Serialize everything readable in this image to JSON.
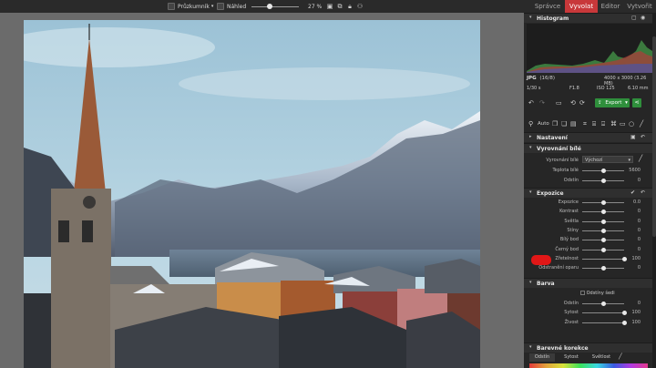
{
  "topbar": {
    "explorer_label": "Průzkumník",
    "preview_label": "Náhled",
    "zoom": "27 %",
    "zoom_fraction": 0.38,
    "tabs": [
      {
        "label": "Správce"
      },
      {
        "label": "Vyvolat"
      },
      {
        "label": "Editor"
      },
      {
        "label": "Vytvořit"
      }
    ],
    "active_tab": "Vyvolat",
    "accent_color": "#c8383a"
  },
  "histogram": {
    "title": "Histogram",
    "file_type": "JPG",
    "bit_depth": "(16/8)",
    "dimensions": "4000 x 3000 (3.26 MB)",
    "shutter": "1/30 s",
    "aperture": "F1.8",
    "iso": "ISO 125",
    "focal": "6.10 mm"
  },
  "toolbar": {
    "export_label": "Export",
    "auto_label": "Auto"
  },
  "sections": {
    "nastaveni": "Nastavení",
    "white_balance": {
      "title": "Vyrovnání bílé",
      "wb_label": "Vyrovnání bílé",
      "wb_value": "Výchozí",
      "temp_label": "Teplota bílé",
      "temp_value": "5600",
      "temp_fraction": 0.5,
      "tint_label": "Odstín",
      "tint_value": "0",
      "tint_fraction": 0.5
    },
    "exposure": {
      "title": "Expozice",
      "rows": [
        {
          "label": "Expozice",
          "value": "0.0",
          "fraction": 0.5
        },
        {
          "label": "Kontrast",
          "value": "0",
          "fraction": 0.5
        },
        {
          "label": "Světla",
          "value": "0",
          "fraction": 0.5
        },
        {
          "label": "Stíny",
          "value": "0",
          "fraction": 0.5
        },
        {
          "label": "Bílý bod",
          "value": "0",
          "fraction": 0.5
        },
        {
          "label": "Černý bod",
          "value": "0",
          "fraction": 0.5
        },
        {
          "label": "Zřetelnost",
          "value": "100",
          "fraction": 1.0
        },
        {
          "label": "Odstranění oparu",
          "value": "0",
          "fraction": 0.5
        }
      ]
    },
    "color": {
      "title": "Barva",
      "checkbox_label": "Odstíny šedi",
      "rows": [
        {
          "label": "Odstín",
          "value": "0",
          "fraction": 0.5
        },
        {
          "label": "Sytost",
          "value": "100",
          "fraction": 1.0
        },
        {
          "label": "Živost",
          "value": "100",
          "fraction": 1.0
        }
      ]
    },
    "color_correction": {
      "title": "Barevné korekce",
      "tabs": [
        "Odstín",
        "Sytost",
        "Světlost"
      ],
      "active_tab": "Odstín"
    }
  },
  "highlight_color": "#e11717"
}
